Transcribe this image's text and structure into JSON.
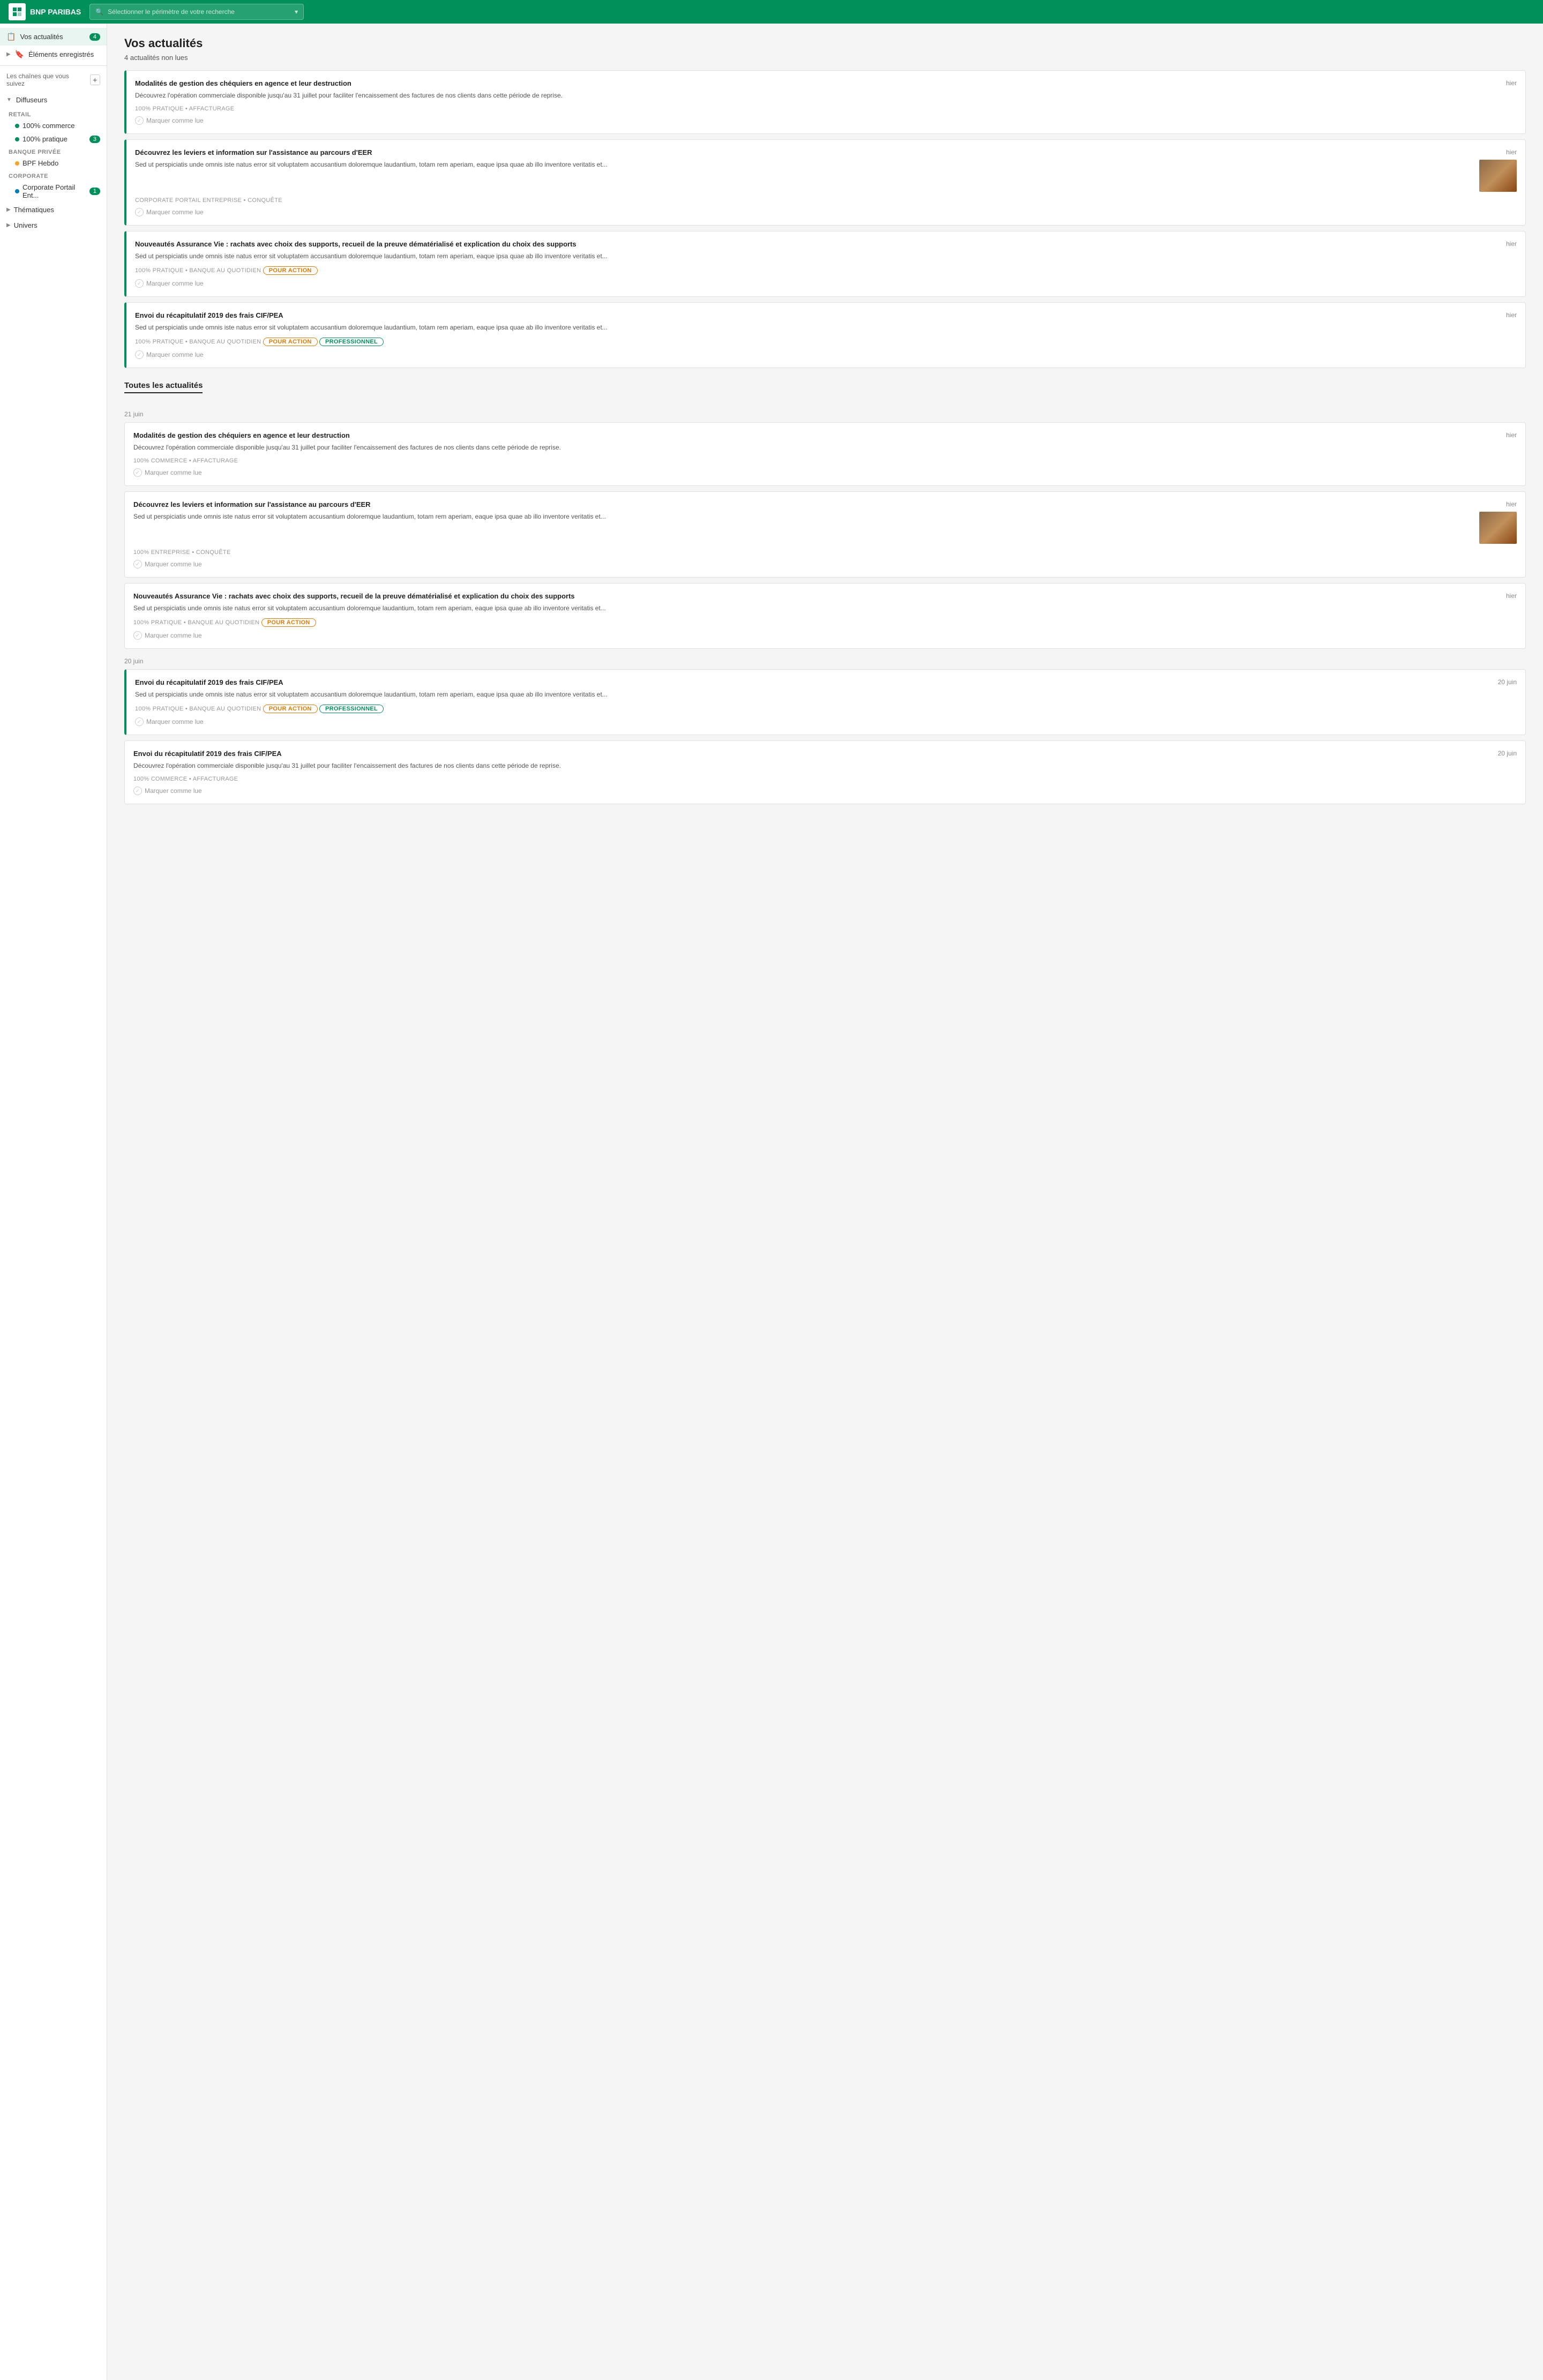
{
  "header": {
    "logo_text": "BNP PARIBAS",
    "search_placeholder": "Sélectionner le périmètre de votre recherche"
  },
  "sidebar": {
    "my_news_label": "Vos actualités",
    "my_news_badge": "4",
    "saved_items_label": "Éléments enregistrés",
    "followed_channels_label": "Les chaînes que vous suivez",
    "diffuseurs_label": "Diffuseurs",
    "retail_label": "RETAIL",
    "retail_item1": "100% commerce",
    "retail_item2": "100% pratique",
    "retail_item2_badge": "3",
    "banque_privee_label": "BANQUE PRIVÉE",
    "banque_privee_item1": "BPF Hebdo",
    "corporate_label": "CORPORATE",
    "corporate_item1": "Corporate Portail Ent...",
    "corporate_item1_badge": "1",
    "thematiques_label": "Thématiques",
    "univers_label": "Univers"
  },
  "main": {
    "page_title": "Vos actualités",
    "unread_count": "4 actualités non lues",
    "unread_news": [
      {
        "title": "Modalités de gestion des chéquiers en agence et leur destruction",
        "date": "hier",
        "text": "Découvrez l'opération commerciale disponible jusqu'au 31 juillet pour faciliter l'encaissement des factures de nos clients dans cette période de reprise.",
        "meta": "100% PRATIQUE • AFFACTURAGE",
        "has_image": false,
        "tags": []
      },
      {
        "title": "Découvrez les leviers et information sur l'assistance au parcours d'EER",
        "date": "hier",
        "text": "Sed ut perspiciatis unde omnis iste natus error sit voluptatem accusantium doloremque laudantium, totam rem aperiam, eaque ipsa quae ab illo inventore veritatis et...",
        "meta": "CORPORATE PORTAIL ENTREPRISE • CONQUÊTE",
        "has_image": true,
        "tags": []
      },
      {
        "title": "Nouveautés Assurance Vie : rachats avec choix des supports, recueil de la preuve dématérialisé et explication du choix des supports",
        "date": "hier",
        "text": "Sed ut perspiciatis unde omnis iste natus error sit voluptatem accusantium doloremque laudantium, totam rem aperiam, eaque ipsa quae ab illo inventore veritatis et...",
        "meta": "100% PRATIQUE • BANQUE AU QUOTIDIEN",
        "has_image": false,
        "tags": [
          "POUR ACTION"
        ]
      },
      {
        "title": "Envoi du récapitulatif 2019 des frais CIF/PEA",
        "date": "hier",
        "text": "Sed ut perspiciatis unde omnis iste natus error sit voluptatem accusantium doloremque laudantium, totam rem aperiam, eaque ipsa quae ab illo inventore veritatis et...",
        "meta": "100% PRATIQUE • BANQUE AU QUOTIDIEN",
        "has_image": false,
        "tags": [
          "POUR ACTION",
          "PROFESSIONNEL"
        ]
      }
    ],
    "all_news_label": "Toutes les actualités",
    "date_group_1": "21 juin",
    "date_group_2": "20 juin",
    "all_news_group1": [
      {
        "title": "Modalités de gestion des chéquiers en agence et leur destruction",
        "date": "hier",
        "text": "Découvrez l'opération commerciale disponible jusqu'au 31 juillet pour faciliter l'encaissement des factures de nos clients dans cette période de reprise.",
        "meta": "100% COMMERCE • AFFACTURAGE",
        "has_image": false,
        "tags": []
      },
      {
        "title": "Découvrez les leviers et information sur l'assistance au parcours d'EER",
        "date": "hier",
        "text": "Sed ut perspiciatis unde omnis iste natus error sit voluptatem accusantium doloremque laudantium, totam rem aperiam, eaque ipsa quae ab illo inventore veritatis et...",
        "meta": "100% ENTREPRISE • CONQUÊTE",
        "has_image": true,
        "tags": []
      },
      {
        "title": "Nouveautés Assurance Vie : rachats avec choix des supports, recueil de la preuve dématérialisé et explication du choix des supports",
        "date": "hier",
        "text": "Sed ut perspiciatis unde omnis iste natus error sit voluptatem accusantium doloremque laudantium, totam rem aperiam, eaque ipsa quae ab illo inventore veritatis et...",
        "meta": "100% PRATIQUE • BANQUE AU QUOTIDIEN",
        "has_image": false,
        "tags": [
          "POUR ACTION"
        ]
      }
    ],
    "all_news_group2": [
      {
        "title": "Envoi du récapitulatif 2019 des frais CIF/PEA",
        "date": "20 juin",
        "text": "Sed ut perspiciatis unde omnis iste natus error sit voluptatem accusantium doloremque laudantium, totam rem aperiam, eaque ipsa quae ab illo inventore veritatis et...",
        "meta": "100% PRATIQUE • BANQUE AU QUOTIDIEN",
        "has_image": false,
        "tags": [
          "POUR ACTION",
          "PROFESSIONNEL"
        ]
      },
      {
        "title": "Envoi du récapitulatif 2019 des frais CIF/PEA",
        "date": "20 juin",
        "text": "Découvrez l'opération commerciale disponible jusqu'au 31 juillet pour faciliter l'encaissement des factures de nos clients dans cette période de reprise.",
        "meta": "100% COMMERCE • AFFACTURAGE",
        "has_image": false,
        "tags": []
      }
    ],
    "mark_read_label": "Marquer comme lue"
  }
}
